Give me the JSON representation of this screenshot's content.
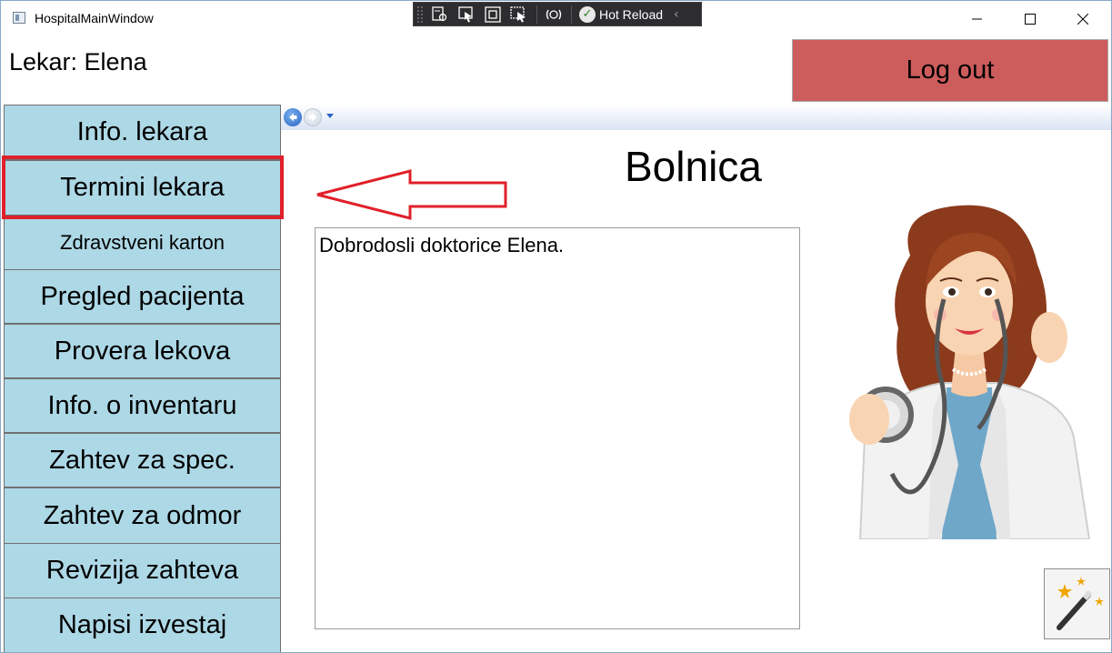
{
  "window": {
    "title": "HospitalMainWindow",
    "controls": {
      "minimize": "—",
      "maximize": "☐",
      "close": "✕"
    }
  },
  "debug_toolbar": {
    "hot_reload_label": "Hot Reload",
    "icons": [
      "live-visual-tree-icon",
      "select-element-icon",
      "display-layout-adorners-icon",
      "track-focus-icon",
      "binding-failures-icon",
      "hot-reload-icon"
    ]
  },
  "header": {
    "doctor_label": "Lekar: Elena",
    "logout_label": "Log out"
  },
  "sidebar": {
    "items": [
      {
        "label": "Info. lekara"
      },
      {
        "label": "Termini lekara"
      },
      {
        "label": "Zdravstveni karton"
      },
      {
        "label": "Pregled pacijenta"
      },
      {
        "label": "Provera lekova"
      },
      {
        "label": "Info. o inventaru"
      },
      {
        "label": "Zahtev za spec."
      },
      {
        "label": "Zahtev za odmor"
      },
      {
        "label": "Revizija zahteva"
      },
      {
        "label": "Napisi izvestaj"
      }
    ]
  },
  "main": {
    "title": "Bolnica",
    "welcome_text": "Dobrodosli doktorice Elena."
  },
  "colors": {
    "nav_button": "#add8e6",
    "logout_button": "#cd5c5c",
    "highlight": "#e0202a"
  }
}
